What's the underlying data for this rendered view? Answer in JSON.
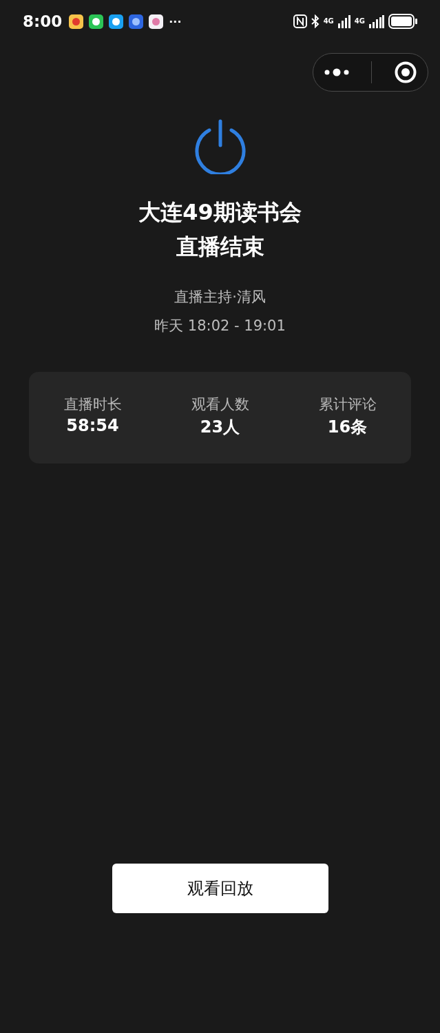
{
  "status_bar": {
    "time": "8:00",
    "overflow": "···",
    "network_1": "4G",
    "network_2": "4G"
  },
  "title_lines": [
    "大连49期读书会",
    "直播结束"
  ],
  "host": "直播主持·清风",
  "time_range": "昨天 18:02 - 19:01",
  "stats": [
    {
      "label": "直播时长",
      "value": "58:54"
    },
    {
      "label": "观看人数",
      "value": "23人"
    },
    {
      "label": "累计评论",
      "value": "16条"
    }
  ],
  "button": "观看回放"
}
